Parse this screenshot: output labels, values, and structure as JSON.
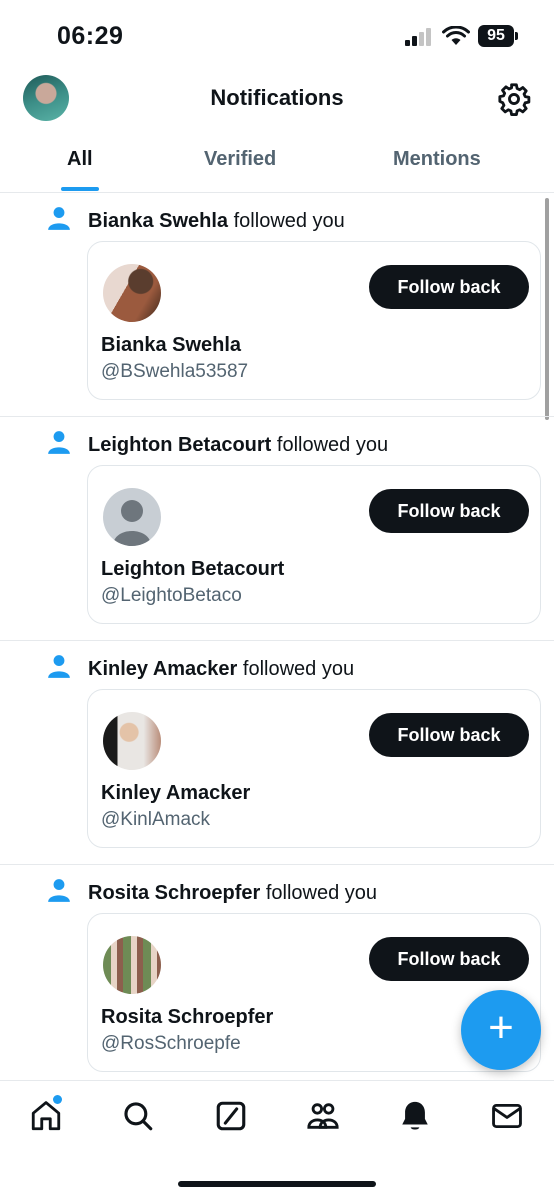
{
  "status_bar": {
    "time": "06:29",
    "battery": "95"
  },
  "header": {
    "title": "Notifications"
  },
  "tabs": [
    {
      "label": "All",
      "active": true
    },
    {
      "label": "Verified",
      "active": false
    },
    {
      "label": "Mentions",
      "active": false
    }
  ],
  "notifications": [
    {
      "name": "Bianka Swehla",
      "action": "followed you",
      "card_name": "Bianka Swehla",
      "handle": "@BSwehla53587",
      "button": "Follow back"
    },
    {
      "name": "Leighton Betacourt",
      "action": "followed you",
      "card_name": "Leighton Betacourt",
      "handle": "@LeightoBetaco",
      "button": "Follow back"
    },
    {
      "name": "Kinley Amacker",
      "action": "followed you",
      "card_name": "Kinley Amacker",
      "handle": "@KinlAmack",
      "button": "Follow back"
    },
    {
      "name": "Rosita Schroepfer",
      "action": "followed you",
      "card_name": "Rosita Schroepfer",
      "handle": "@RosSchroepfe",
      "button": "Follow back"
    }
  ],
  "fab": {
    "label": "+"
  },
  "bottom_nav": {
    "items": [
      "home-icon",
      "search-icon",
      "grok-icon",
      "communities-icon",
      "notifications-icon",
      "messages-icon"
    ],
    "active": "notifications-icon"
  },
  "colors": {
    "accent": "#1d9bf0",
    "text": "#0f1419",
    "secondary": "#536471",
    "border": "#e6e9ec"
  }
}
